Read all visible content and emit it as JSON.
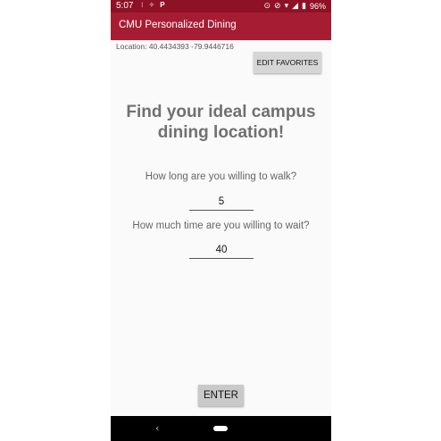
{
  "status_bar": {
    "time": "5:07",
    "battery": "96%",
    "icons": [
      "notification-icon",
      "sync-icon",
      "parking-icon",
      "location-icon",
      "do-not-disturb-icon",
      "wifi-icon",
      "signal-icon",
      "battery-icon"
    ]
  },
  "app_bar": {
    "title": "CMU Personalized Dining"
  },
  "location_text": "Location: 40.4434393 -79.9446716",
  "favorites_button": "EDIT FAVORITES",
  "headline": "Find your ideal campus dining location!",
  "walk": {
    "question": "How long are you willing to walk?",
    "value": "5"
  },
  "wait": {
    "question": "How much time are you willing to wait?",
    "value": "40"
  },
  "enter_button": "ENTER",
  "colors": {
    "status_bar": "#8e1125",
    "app_bar": "#a61c32",
    "background": "#fafafa",
    "button": "#d6d6d6"
  }
}
